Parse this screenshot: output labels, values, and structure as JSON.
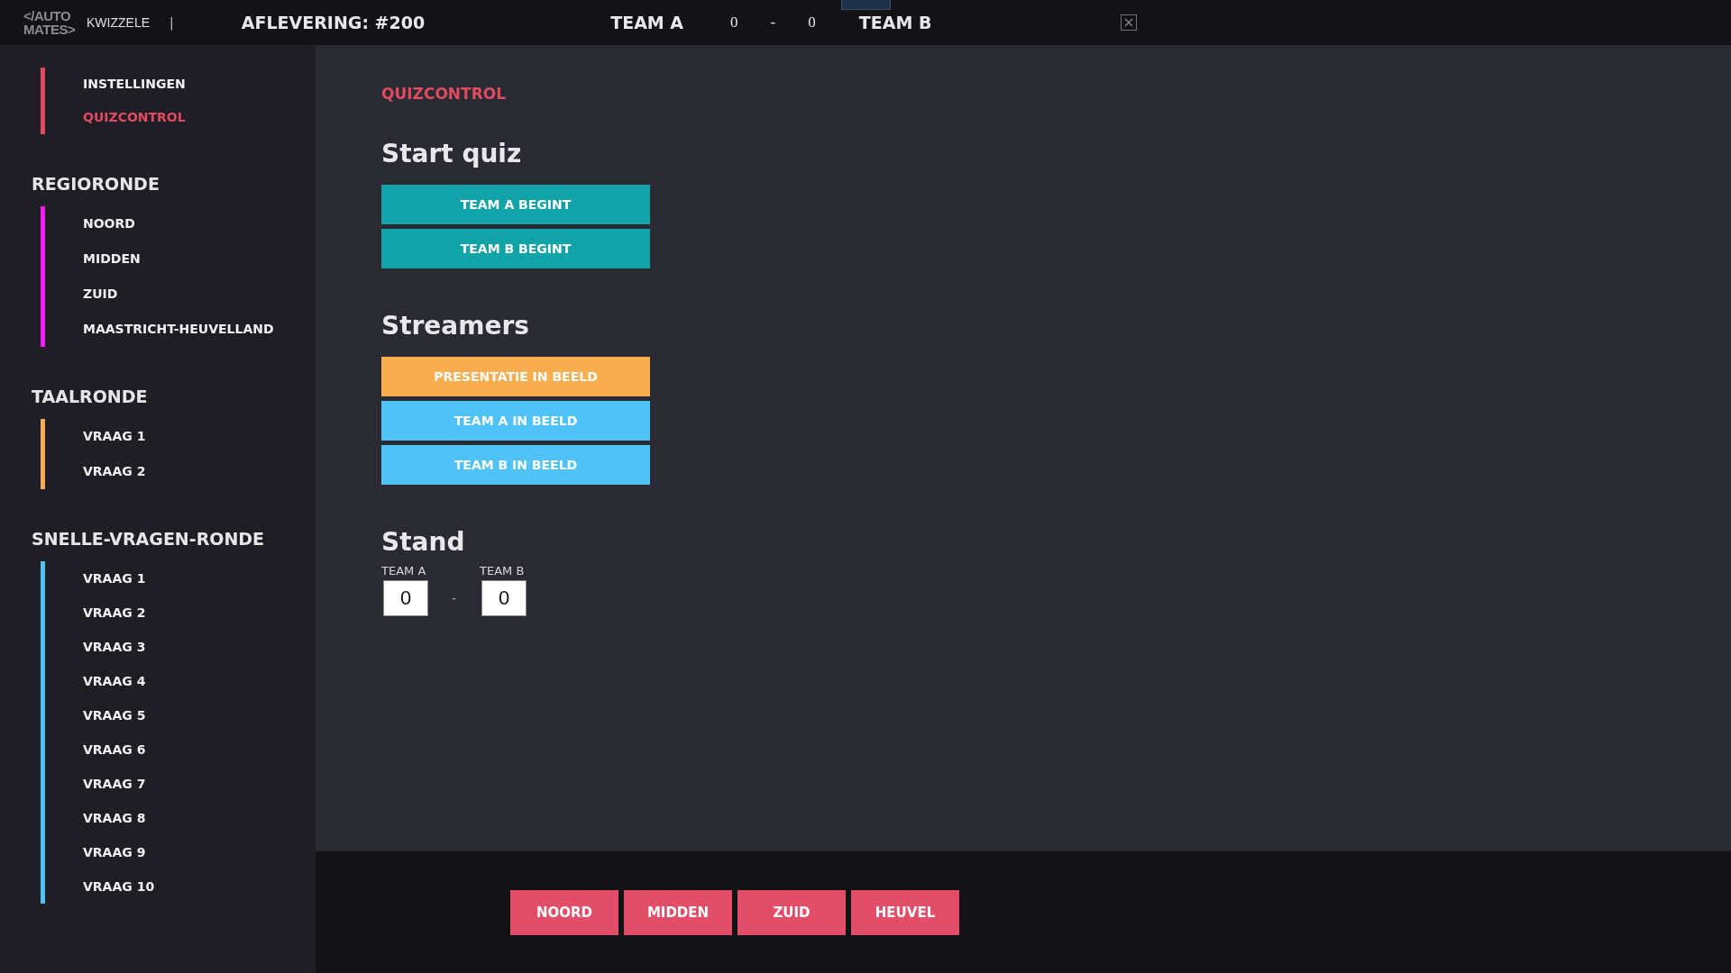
{
  "topbar": {
    "logo": [
      "</AUTO",
      "MATES>"
    ],
    "app_name": "KWIZZELE",
    "separator": "|",
    "episode": "AFLEVERING: #200",
    "team_a": "TEAM A",
    "score_a": "0",
    "score_sep": "-",
    "score_b": "0",
    "team_b": "TEAM B"
  },
  "sidebar": {
    "groups": [
      {
        "color": "#e04b62",
        "items": [
          {
            "label": "INSTELLINGEN",
            "selected": false
          },
          {
            "label": "QUIZCONTROL",
            "selected": true
          }
        ]
      },
      {
        "title": "REGIORONDE",
        "color": "#ff1aff",
        "items": [
          {
            "label": "NOORD",
            "selected": false
          },
          {
            "label": "MIDDEN",
            "selected": false
          },
          {
            "label": "ZUID",
            "selected": false
          },
          {
            "label": "MAASTRICHT-HEUVELLAND",
            "selected": false
          }
        ]
      },
      {
        "title": "TAALRONDE",
        "color": "#f8ac4d",
        "items": [
          {
            "label": "VRAAG 1",
            "selected": false
          },
          {
            "label": "VRAAG 2",
            "selected": false
          }
        ]
      },
      {
        "title": "SNELLE-VRAGEN-RONDE",
        "color": "#4fc3f7",
        "items": [
          {
            "label": "VRAAG 1",
            "selected": false
          },
          {
            "label": "VRAAG 2",
            "selected": false
          },
          {
            "label": "VRAAG 3",
            "selected": false
          },
          {
            "label": "VRAAG 4",
            "selected": false
          },
          {
            "label": "VRAAG 5",
            "selected": false
          },
          {
            "label": "VRAAG 6",
            "selected": false
          },
          {
            "label": "VRAAG 7",
            "selected": false
          },
          {
            "label": "VRAAG 8",
            "selected": false
          },
          {
            "label": "VRAAG 9",
            "selected": false
          },
          {
            "label": "VRAAG 10",
            "selected": false
          }
        ]
      }
    ]
  },
  "main": {
    "page_title": "QUIZCONTROL",
    "sections": [
      {
        "heading": "Start quiz",
        "buttons": [
          {
            "label": "TEAM A BEGINT",
            "color": "#12a3a8"
          },
          {
            "label": "TEAM B BEGINT",
            "color": "#12a3a8"
          }
        ]
      },
      {
        "heading": "Streamers",
        "buttons": [
          {
            "label": "PRESENTATIE IN BEELD",
            "color": "#f8ae4f"
          },
          {
            "label": "TEAM A IN BEELD",
            "color": "#4fc3f7"
          },
          {
            "label": "TEAM B IN BEELD",
            "color": "#4fc3f7"
          }
        ]
      }
    ],
    "stand": {
      "heading": "Stand",
      "team_a_label": "TEAM A",
      "team_a_value": "0",
      "separator": "-",
      "team_b_label": "TEAM B",
      "team_b_value": "0"
    }
  },
  "bottom_bar": {
    "buttons": [
      "NOORD",
      "MIDDEN",
      "ZUID",
      "HEUVEL"
    ]
  }
}
